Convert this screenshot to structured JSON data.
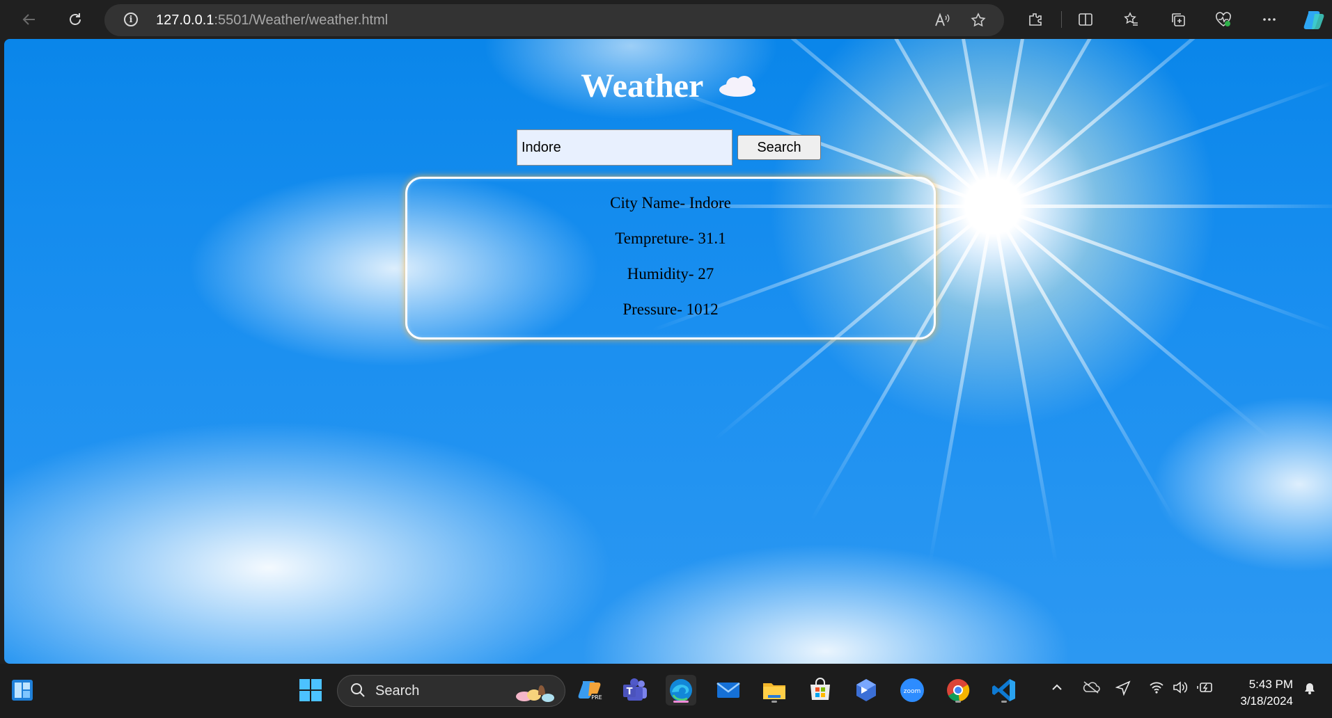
{
  "browser": {
    "url_host": "127.0.0.1",
    "url_path": ":5501/Weather/weather.html",
    "info_glyph": "i"
  },
  "page": {
    "title": "Weather",
    "search_value": "Indore",
    "search_button": "Search",
    "weather": {
      "city": "City Name- Indore",
      "temperature": "Tempreture- 31.1",
      "humidity": "Humidity- 27",
      "pressure": "Pressure- 1012"
    }
  },
  "taskbar": {
    "search_label": "Search",
    "time": "5:43 PM",
    "date": "3/18/2024",
    "apps": [
      "copilot-app",
      "teams-app",
      "edge-app",
      "mail-app",
      "file-explorer-app",
      "store-app",
      "power-automate-app",
      "zoom-app",
      "chrome-app",
      "vscode-app"
    ]
  },
  "colors": {
    "sky": "#1a8ff0",
    "taskbar": "#1c1c1c",
    "browser_chrome": "#202020"
  }
}
